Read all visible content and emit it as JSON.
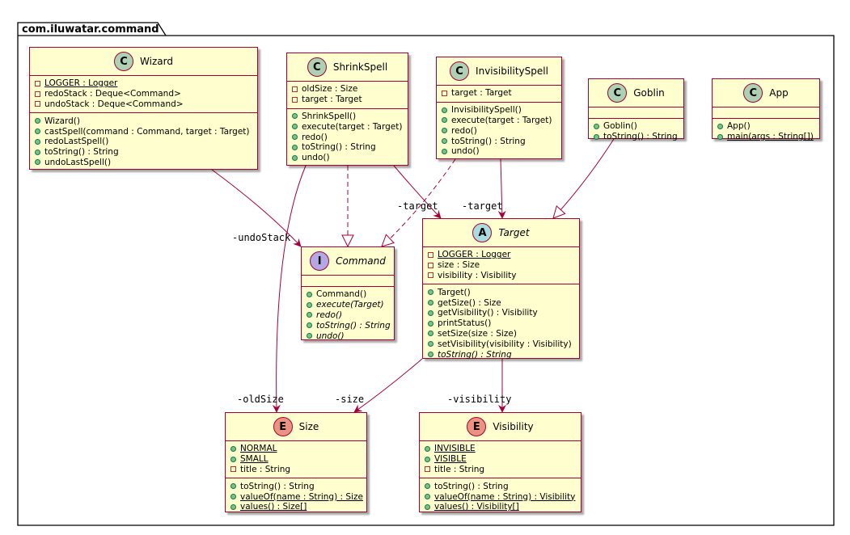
{
  "package": {
    "name": "com.iluwatar.command"
  },
  "boxes": {
    "wizard": {
      "kind": "C",
      "name": "Wizard",
      "fields": [
        {
          "vis": "priv",
          "text": "LOGGER : Logger",
          "underline": true
        },
        {
          "vis": "priv",
          "text": "redoStack : Deque<Command>"
        },
        {
          "vis": "priv",
          "text": "undoStack : Deque<Command>"
        }
      ],
      "methods": [
        {
          "vis": "pub",
          "text": "Wizard()"
        },
        {
          "vis": "pub",
          "text": "castSpell(command : Command, target : Target)"
        },
        {
          "vis": "pub",
          "text": "redoLastSpell()"
        },
        {
          "vis": "pub",
          "text": "toString() : String"
        },
        {
          "vis": "pub",
          "text": "undoLastSpell()"
        }
      ]
    },
    "shrinkspell": {
      "kind": "C",
      "name": "ShrinkSpell",
      "fields": [
        {
          "vis": "priv",
          "text": "oldSize : Size"
        },
        {
          "vis": "priv",
          "text": "target : Target"
        }
      ],
      "methods": [
        {
          "vis": "pub",
          "text": "ShrinkSpell()"
        },
        {
          "vis": "pub",
          "text": "execute(target : Target)"
        },
        {
          "vis": "pub",
          "text": "redo()"
        },
        {
          "vis": "pub",
          "text": "toString() : String"
        },
        {
          "vis": "pub",
          "text": "undo()"
        }
      ]
    },
    "invisibilityspell": {
      "kind": "C",
      "name": "InvisibilitySpell",
      "fields": [
        {
          "vis": "priv",
          "text": "target : Target"
        }
      ],
      "methods": [
        {
          "vis": "pub",
          "text": "InvisibilitySpell()"
        },
        {
          "vis": "pub",
          "text": "execute(target : Target)"
        },
        {
          "vis": "pub",
          "text": "redo()"
        },
        {
          "vis": "pub",
          "text": "toString() : String"
        },
        {
          "vis": "pub",
          "text": "undo()"
        }
      ]
    },
    "goblin": {
      "kind": "C",
      "name": "Goblin",
      "fields": [],
      "methods": [
        {
          "vis": "pub",
          "text": "Goblin()"
        },
        {
          "vis": "pub",
          "text": "toString() : String"
        }
      ]
    },
    "app": {
      "kind": "C",
      "name": "App",
      "fields": [],
      "methods": [
        {
          "vis": "pub",
          "text": "App()"
        },
        {
          "vis": "pub",
          "text": "main(args : String[])",
          "underline": true
        }
      ]
    },
    "command": {
      "kind": "I",
      "name": "Command",
      "italic": true,
      "fields": [],
      "methods": [
        {
          "vis": "pub",
          "text": "Command()"
        },
        {
          "vis": "pub",
          "text": "execute(Target)",
          "italic": true
        },
        {
          "vis": "pub",
          "text": "redo()",
          "italic": true
        },
        {
          "vis": "pub",
          "text": "toString() : String",
          "italic": true
        },
        {
          "vis": "pub",
          "text": "undo()",
          "italic": true
        }
      ]
    },
    "target": {
      "kind": "A",
      "name": "Target",
      "italic": true,
      "fields": [
        {
          "vis": "priv",
          "text": "LOGGER : Logger",
          "underline": true
        },
        {
          "vis": "priv",
          "text": "size : Size"
        },
        {
          "vis": "priv",
          "text": "visibility : Visibility"
        }
      ],
      "methods": [
        {
          "vis": "pub",
          "text": "Target()"
        },
        {
          "vis": "pub",
          "text": "getSize() : Size"
        },
        {
          "vis": "pub",
          "text": "getVisibility() : Visibility"
        },
        {
          "vis": "pub",
          "text": "printStatus()"
        },
        {
          "vis": "pub",
          "text": "setSize(size : Size)"
        },
        {
          "vis": "pub",
          "text": "setVisibility(visibility : Visibility)"
        },
        {
          "vis": "pub",
          "text": "toString() : String",
          "italic": true
        }
      ]
    },
    "size": {
      "kind": "E",
      "name": "Size",
      "fields": [
        {
          "vis": "pub",
          "text": "NORMAL",
          "underline": true
        },
        {
          "vis": "pub",
          "text": "SMALL",
          "underline": true
        },
        {
          "vis": "priv",
          "text": "title : String"
        }
      ],
      "methods": [
        {
          "vis": "pub",
          "text": "toString() : String"
        },
        {
          "vis": "pub",
          "text": "valueOf(name : String) : Size",
          "underline": true
        },
        {
          "vis": "pub",
          "text": "values() : Size[]",
          "underline": true
        }
      ]
    },
    "visibility": {
      "kind": "E",
      "name": "Visibility",
      "fields": [
        {
          "vis": "pub",
          "text": "INVISIBLE",
          "underline": true
        },
        {
          "vis": "pub",
          "text": "VISIBLE",
          "underline": true
        },
        {
          "vis": "priv",
          "text": "title : String"
        }
      ],
      "methods": [
        {
          "vis": "pub",
          "text": "toString() : String"
        },
        {
          "vis": "pub",
          "text": "valueOf(name : String) : Visibility",
          "underline": true
        },
        {
          "vis": "pub",
          "text": "values() : Visibility[]",
          "underline": true
        }
      ]
    }
  },
  "edge_labels": {
    "undo_stack": "-undoStack",
    "shrink_target": "-target",
    "invis_target": "-target",
    "old_size": "-oldSize",
    "size": "-size",
    "visibility": "-visibility"
  },
  "colors": {
    "border": "#a80036",
    "box_fill": "#fefece",
    "class_circle": "#add1b2",
    "abstract_circle": "#a9dcdf",
    "interface_circle": "#b4a7e5",
    "enum_circle": "#eb937f"
  }
}
